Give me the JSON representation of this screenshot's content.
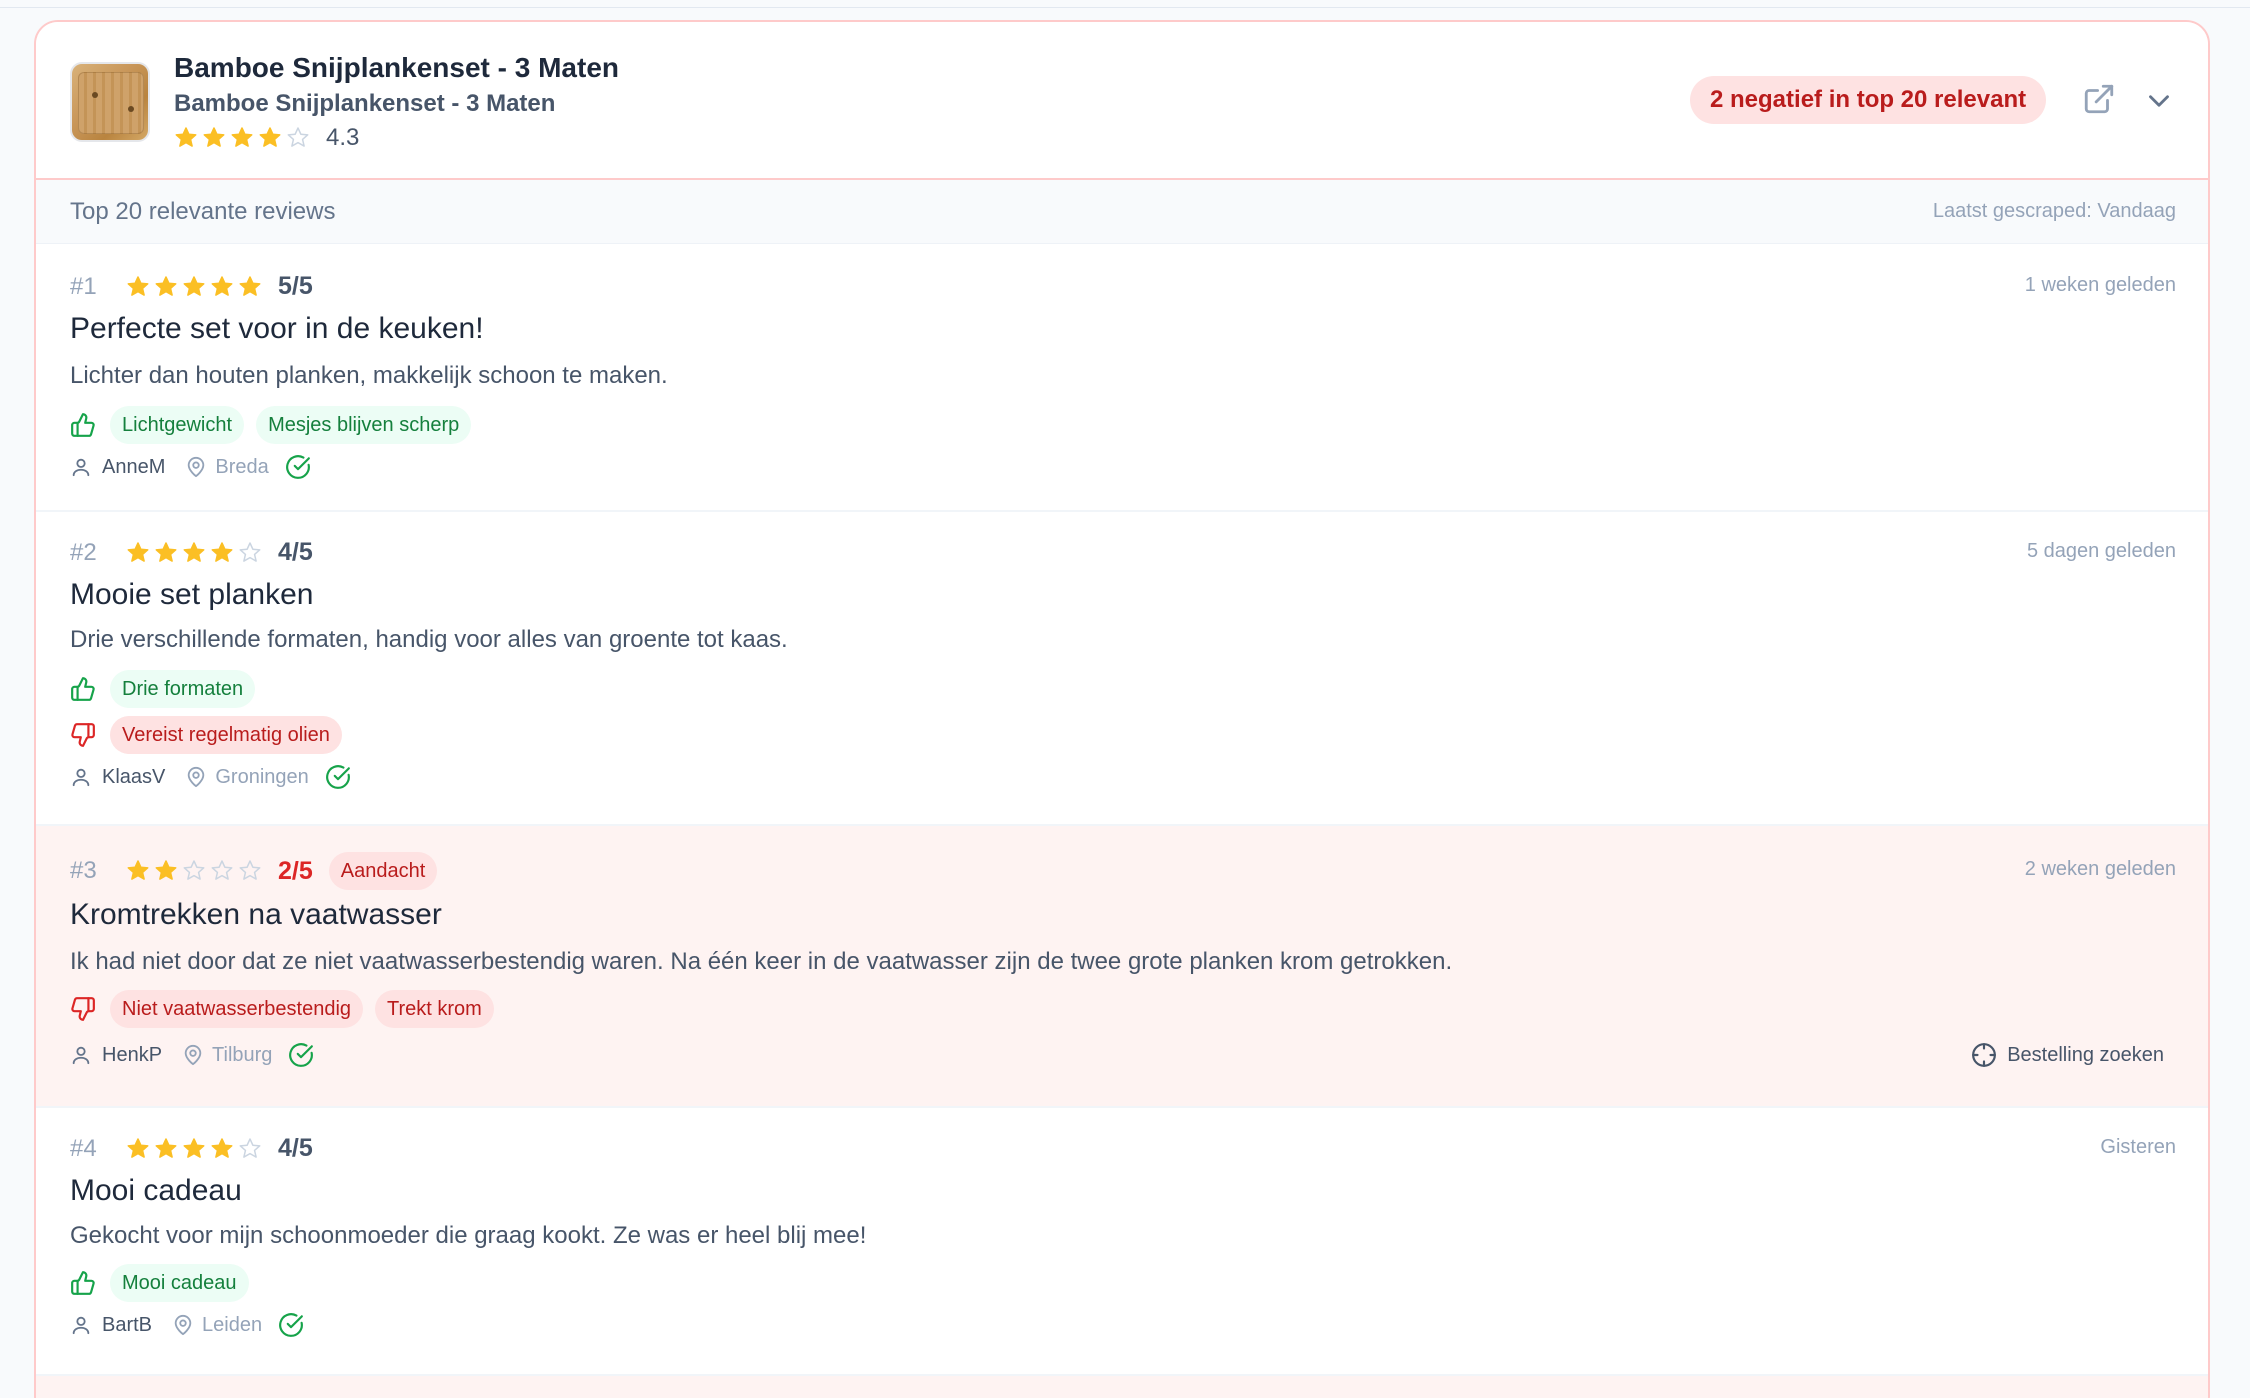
{
  "product": {
    "title": "Bamboe Snijplankenset - 3 Maten",
    "subtitle": "Bamboe Snijplankenset - 3 Maten",
    "rating": 4.3,
    "rating_text": "4.3",
    "stars_filled": 4,
    "thumbnail_icon": "cutting-board-image",
    "negative_badge": "2 negatief in top 20 relevant",
    "external_link_icon": "external-link-icon",
    "expand_icon": "chevron-down-icon"
  },
  "subheader": {
    "title": "Top 20 relevante reviews",
    "scraped": "Laatst gescraped: Vandaag"
  },
  "colors": {
    "star": "#fbbf24",
    "star_empty": "#cbd5e1",
    "positive": "#16a34a",
    "negative": "#dc2626",
    "card_border": "#fecaca",
    "flagged_bg": "#fef3f2"
  },
  "reviews": [
    {
      "num": "#1",
      "stars": 5,
      "score": "5/5",
      "time": "1 weken geleden",
      "title": "Perfecte set voor in de keuken!",
      "body": "Lichter dan houten planken, makkelijk schoon te maken.",
      "pros": [
        "Lichtgewicht",
        "Mesjes blijven scherp"
      ],
      "cons": [],
      "author": "AnneM",
      "location": "Breda",
      "verified": true
    },
    {
      "num": "#2",
      "stars": 4,
      "score": "4/5",
      "time": "5 dagen geleden",
      "title": "Mooie set planken",
      "body": "Drie verschillende formaten, handig voor alles van groente tot kaas.",
      "pros": [
        "Drie formaten"
      ],
      "cons": [
        "Vereist regelmatig olien"
      ],
      "author": "KlaasV",
      "location": "Groningen",
      "verified": true
    },
    {
      "num": "#3",
      "stars": 2,
      "score": "2/5",
      "badge": "Aandacht",
      "time": "2 weken geleden",
      "title": "Kromtrekken na vaatwasser",
      "body": "Ik had niet door dat ze niet vaatwasserbestendig waren. Na één keer in de vaatwasser zijn de twee grote planken krom getrokken.",
      "pros": [],
      "cons": [
        "Niet vaatwasserbestendig",
        "Trekt krom"
      ],
      "author": "HenkP",
      "location": "Tilburg",
      "verified": true,
      "action": "Bestelling zoeken"
    },
    {
      "num": "#4",
      "stars": 4,
      "score": "4/5",
      "time": "Gisteren",
      "title": "Mooi cadeau",
      "body": "Gekocht voor mijn schoonmoeder die graag kookt. Ze was er heel blij mee!",
      "pros": [
        "Mooi cadeau"
      ],
      "cons": [],
      "author": "BartB",
      "location": "Leiden",
      "verified": true
    }
  ]
}
